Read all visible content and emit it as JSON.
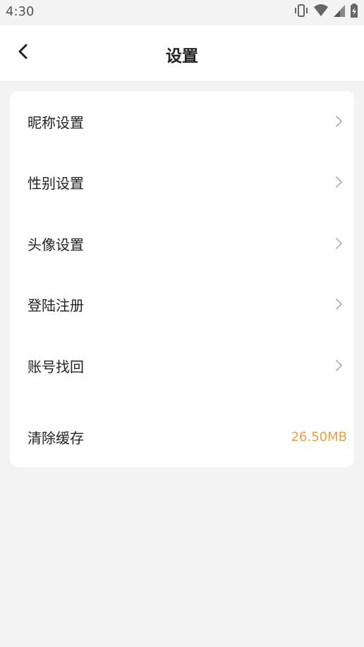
{
  "status_bar": {
    "time": "4:30",
    "icons": [
      "vibrate-icon",
      "wifi-icon",
      "signal-icon",
      "battery-charging-icon"
    ]
  },
  "header": {
    "title": "设置",
    "back_icon": "chevron-left-icon"
  },
  "settings": {
    "items": [
      {
        "label": "昵称设置",
        "icon": "chevron-right-icon"
      },
      {
        "label": "性别设置",
        "icon": "chevron-right-icon"
      },
      {
        "label": "头像设置",
        "icon": "chevron-right-icon"
      },
      {
        "label": "登陆注册",
        "icon": "chevron-right-icon"
      },
      {
        "label": "账号找回",
        "icon": "chevron-right-icon"
      }
    ],
    "cache": {
      "label": "清除缓存",
      "value": "26.50MB"
    }
  },
  "colors": {
    "background": "#f3f3f3",
    "card": "#ffffff",
    "text": "#222222",
    "chevron": "#b0b0b0",
    "cache_value": "#e8a04a"
  }
}
